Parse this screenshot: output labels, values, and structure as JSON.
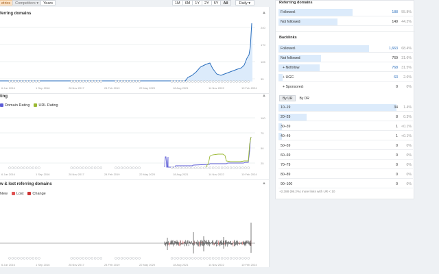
{
  "toolbar": {
    "metrics_label": "etrics",
    "competitors_label": "Competitors",
    "years_label": "Years",
    "ranges": [
      "1M",
      "6M",
      "1Y",
      "2Y",
      "5Y",
      "All"
    ],
    "active_range": "All",
    "granularity": "Daily"
  },
  "section1": {
    "title": "ferring domains",
    "ticks_y": [
      "240",
      "170",
      "105",
      "35"
    ],
    "ticks_x": [
      "6 Jun 2016",
      "1 Sep 2018",
      "28 Nov 2017",
      "24 Feb 2019",
      "22 May 2020",
      "18 Aug 2021",
      "14 Nov 2022",
      "10 Feb 2024"
    ]
  },
  "section2": {
    "title": "ting",
    "legend_dr": "Domain Rating",
    "legend_ur": "URL Rating",
    "ticks_y": [
      "100",
      "75",
      "50",
      "25"
    ],
    "ticks_x": [
      "6 Jun 2016",
      "1 Sep 2016",
      "28 Nov 2017",
      "24 Feb 2019",
      "22 May 2020",
      "18 Aug 2021",
      "14 Nov 2022",
      "10 Feb 2024"
    ]
  },
  "section3": {
    "title": "w & lost referring domains",
    "legend_new": "New",
    "legend_lost": "Lost",
    "legend_change": "Change",
    "ticks_x": [
      "6 Jun 2016",
      "1 Sep 2016",
      "28 Nov 2017",
      "24 Feb 2019",
      "22 May 2020",
      "18 Aug 2021",
      "14 Nov 2022",
      "10 Feb 2024"
    ]
  },
  "chart_data": [
    {
      "type": "area",
      "title": "",
      "x": [
        "6 Jun 2016",
        "1 Sep 2018",
        "28 Nov 2017",
        "24 Feb 2019",
        "22 May 2020",
        "18 Aug 2021",
        "14 Nov 2022",
        "10 Feb 2024"
      ],
      "series": [
        {
          "values": [
            0,
            0,
            0,
            0,
            0,
            80,
            110,
            240
          ]
        }
      ],
      "ylim": [
        0,
        260
      ]
    },
    {
      "type": "line",
      "title": "",
      "series": [
        {
          "name": "Domain Rating",
          "values": [
            0,
            0,
            0,
            0,
            8,
            10,
            12,
            60
          ]
        },
        {
          "name": "URL Rating",
          "values": [
            0,
            0,
            0,
            0,
            0,
            0,
            25,
            60
          ]
        }
      ],
      "ylim": [
        0,
        100
      ]
    },
    {
      "type": "bar",
      "title": "",
      "series": [
        {
          "name": "New",
          "values": []
        },
        {
          "name": "Lost",
          "values": []
        },
        {
          "name": "Change",
          "values": []
        }
      ]
    }
  ],
  "ref_domains": {
    "title": "Referring domains",
    "rows": [
      {
        "label": "Followed",
        "value": "188",
        "pct": "55.8%",
        "bar": 0.56
      },
      {
        "label": "Not followed",
        "value": "149",
        "pct": "44.2%",
        "bar": 0.44
      }
    ]
  },
  "backlinks": {
    "title": "Backlinks",
    "rows": [
      {
        "label": "Followed",
        "value": "1,663",
        "pct": "68.4%",
        "bar": 0.68,
        "indent": false
      },
      {
        "label": "Not followed",
        "value": "769",
        "pct": "31.6%",
        "bar": 0.32,
        "indent": false
      },
      {
        "label": "Nofollow",
        "value": "768",
        "pct": "31.5%",
        "bar": 0.31,
        "indent": true
      },
      {
        "label": "UGC",
        "value": "63",
        "pct": "2.6%",
        "bar": 0.03,
        "indent": true
      },
      {
        "label": "Sponsored",
        "value": "0",
        "pct": "0%",
        "bar": 0,
        "indent": true
      }
    ]
  },
  "rating_tabs": [
    "By UR",
    "By DR"
  ],
  "active_rating_tab": "By UR",
  "ur_table": [
    {
      "label": "10–19",
      "value": "34",
      "pct": "1.4%",
      "bar": 1.0
    },
    {
      "label": "20–29",
      "value": "8",
      "pct": "0.3%",
      "bar": 0.24
    },
    {
      "label": "30–39",
      "value": "1",
      "pct": "<0.1%",
      "bar": 0.03
    },
    {
      "label": "40–49",
      "value": "1",
      "pct": "<0.1%",
      "bar": 0.03
    },
    {
      "label": "50–59",
      "value": "0",
      "pct": "0%",
      "bar": 0
    },
    {
      "label": "60–69",
      "value": "0",
      "pct": "0%",
      "bar": 0
    },
    {
      "label": "70–79",
      "value": "0",
      "pct": "0%",
      "bar": 0
    },
    {
      "label": "80–89",
      "value": "0",
      "pct": "0%",
      "bar": 0
    },
    {
      "label": "90–100",
      "value": "0",
      "pct": "0%",
      "bar": 0
    }
  ],
  "footer_note": "+2,388 (98.2%) more links with UR < 10",
  "colors": {
    "accent": "#2a6ebd",
    "area_fill": "#dcebfb",
    "dr_line": "#5b5bd6",
    "ur_line": "#9ab832",
    "lost": "#e05252"
  }
}
